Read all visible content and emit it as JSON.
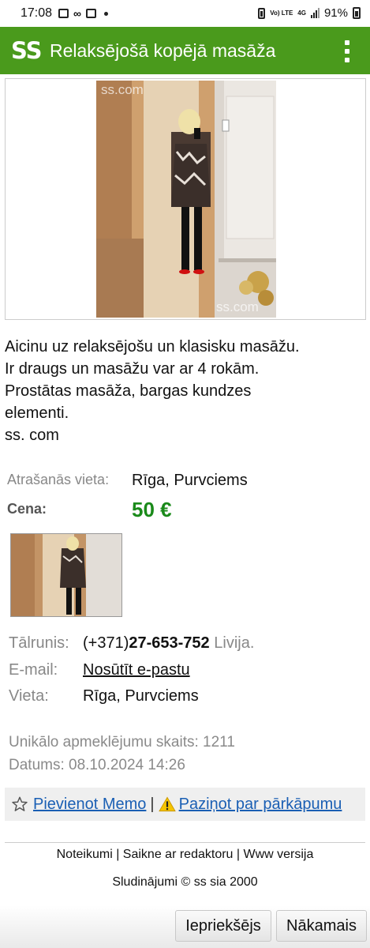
{
  "status_bar": {
    "time": "17:08",
    "network": "4G",
    "volte": "Vo) LTE",
    "battery": "91%"
  },
  "app_bar": {
    "logo": "SS",
    "title": "Relaksējošā kopējā masāža",
    "menu_icon": "more-vertical-icon",
    "background_color": "#4a9a1c"
  },
  "listing": {
    "photo_watermark": "ss.com",
    "description_lines": [
      "Aicinu uz relaksējošu un klasisku masāžu.",
      "Ir draugs un masāžu var ar 4 rokām.",
      "Prostātas masāža, bargas kundzes",
      "elementi.",
      "ss. com"
    ],
    "location_label": "Atrašanās vieta:",
    "location_value": "Rīga, Purvciems",
    "price_label": "Cena:",
    "price_value": "50 €",
    "price_color": "#1a8a1a"
  },
  "contact": {
    "phone_label": "Tālrunis:",
    "phone_prefix": "(+371)",
    "phone_number": "27-653-752",
    "phone_name": "Livija.",
    "email_label": "E-mail:",
    "email_link": "Nosūtīt e-pastu",
    "place_label": "Vieta:",
    "place_value": "Rīga, Purvciems"
  },
  "stats": {
    "visits": "Unikālo apmeklējumu skaits: 1211",
    "date": "Datums: 08.10.2024 14:26"
  },
  "actions": {
    "memo_icon": "star-icon",
    "memo_label": "Pievienot Memo",
    "separator": "|",
    "report_icon": "warning-icon",
    "report_label": "Paziņot par pārkāpumu"
  },
  "footer": {
    "links": "Noteikumi | Saikne ar redaktoru | Www versija",
    "copyright": "Sludinājumi © ss sia 2000"
  },
  "nav": {
    "prev_label": "Iepriekšējs",
    "next_label": "Nākamais"
  }
}
